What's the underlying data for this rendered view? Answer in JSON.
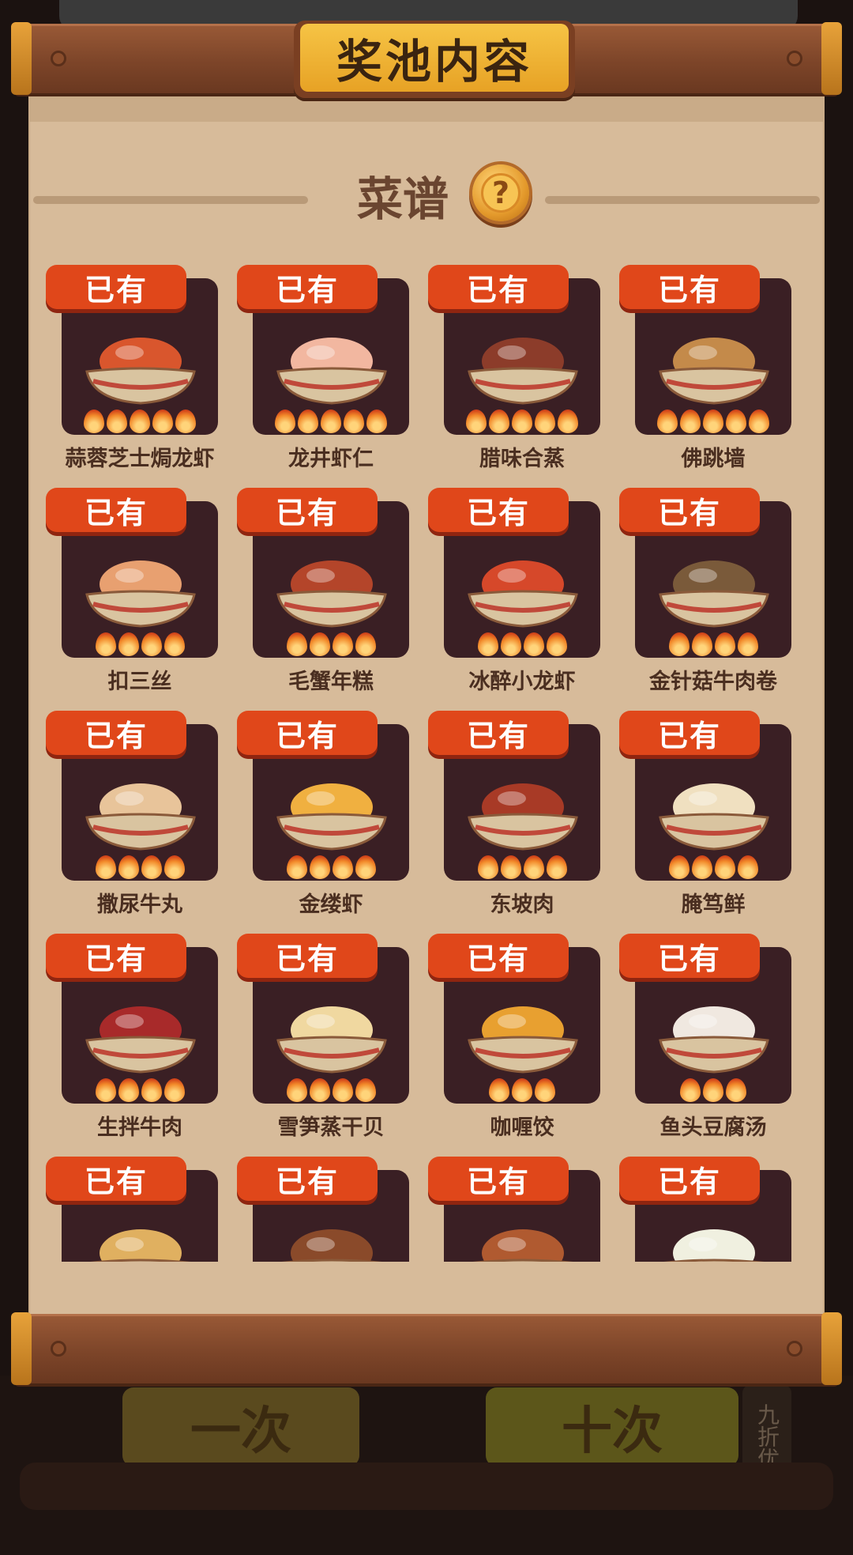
{
  "title": "奖池内容",
  "section": {
    "title": "菜谱",
    "help_icon": "question-mark-icon"
  },
  "badge_label": "已有",
  "background": {
    "one_pull": "一次",
    "ten_pull": "十次",
    "discount": "九折优惠"
  },
  "dishes": [
    {
      "name": "蒜蓉芝士焗龙虾",
      "rating": 5,
      "color": "#d9562d"
    },
    {
      "name": "龙井虾仁",
      "rating": 5,
      "color": "#f2b7a0"
    },
    {
      "name": "腊味合蒸",
      "rating": 5,
      "color": "#8c3c2a"
    },
    {
      "name": "佛跳墙",
      "rating": 5,
      "color": "#c48a4a"
    },
    {
      "name": "扣三丝",
      "rating": 4,
      "color": "#e8a070"
    },
    {
      "name": "毛蟹年糕",
      "rating": 4,
      "color": "#b4452a"
    },
    {
      "name": "冰醉小龙虾",
      "rating": 4,
      "color": "#d6482a"
    },
    {
      "name": "金针菇牛肉卷",
      "rating": 4,
      "color": "#7a5a3a"
    },
    {
      "name": "撒尿牛丸",
      "rating": 4,
      "color": "#e8c49a"
    },
    {
      "name": "金缕虾",
      "rating": 4,
      "color": "#f0b040"
    },
    {
      "name": "东坡肉",
      "rating": 4,
      "color": "#a83a26"
    },
    {
      "name": "腌笃鲜",
      "rating": 4,
      "color": "#f0e0c0"
    },
    {
      "name": "生拌牛肉",
      "rating": 4,
      "color": "#a82a2a"
    },
    {
      "name": "雪笋蒸干贝",
      "rating": 4,
      "color": "#f0d8a0"
    },
    {
      "name": "咖喱饺",
      "rating": 3,
      "color": "#e8a030"
    },
    {
      "name": "鱼头豆腐汤",
      "rating": 3,
      "color": "#f0e8e0"
    },
    {
      "name": "",
      "rating": 0,
      "color": "#e0b060"
    },
    {
      "name": "",
      "rating": 0,
      "color": "#8a4a2a"
    },
    {
      "name": "",
      "rating": 0,
      "color": "#b05a30"
    },
    {
      "name": "",
      "rating": 0,
      "color": "#f0f0e0"
    }
  ]
}
